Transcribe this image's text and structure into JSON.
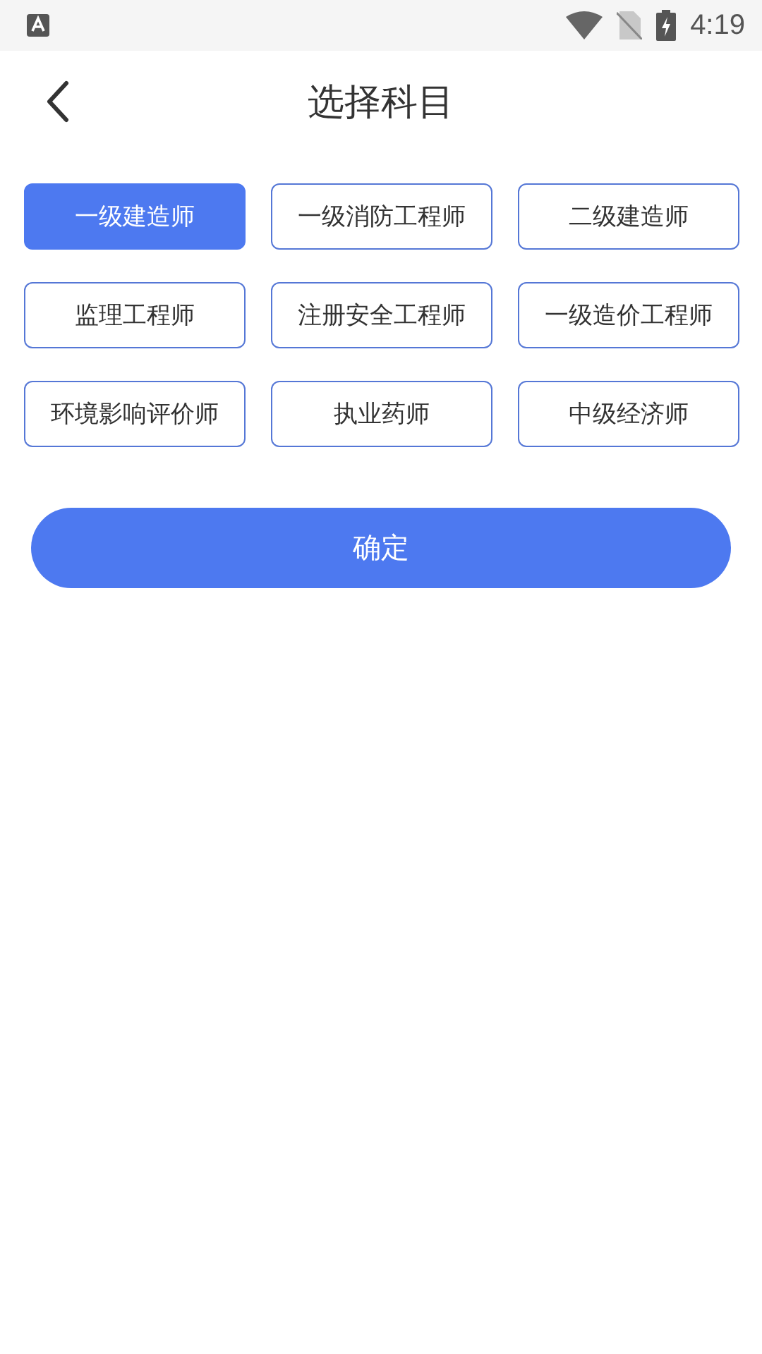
{
  "status_bar": {
    "time": "4:19"
  },
  "header": {
    "title": "选择科目"
  },
  "subjects": [
    {
      "label": "一级建造师",
      "selected": true
    },
    {
      "label": "一级消防工程师",
      "selected": false
    },
    {
      "label": "二级建造师",
      "selected": false
    },
    {
      "label": "监理工程师",
      "selected": false
    },
    {
      "label": "注册安全工程师",
      "selected": false
    },
    {
      "label": "一级造价工程师",
      "selected": false
    },
    {
      "label": "环境影响评价师",
      "selected": false
    },
    {
      "label": "执业药师",
      "selected": false
    },
    {
      "label": "中级经济师",
      "selected": false
    }
  ],
  "confirm_button": {
    "label": "确定"
  }
}
